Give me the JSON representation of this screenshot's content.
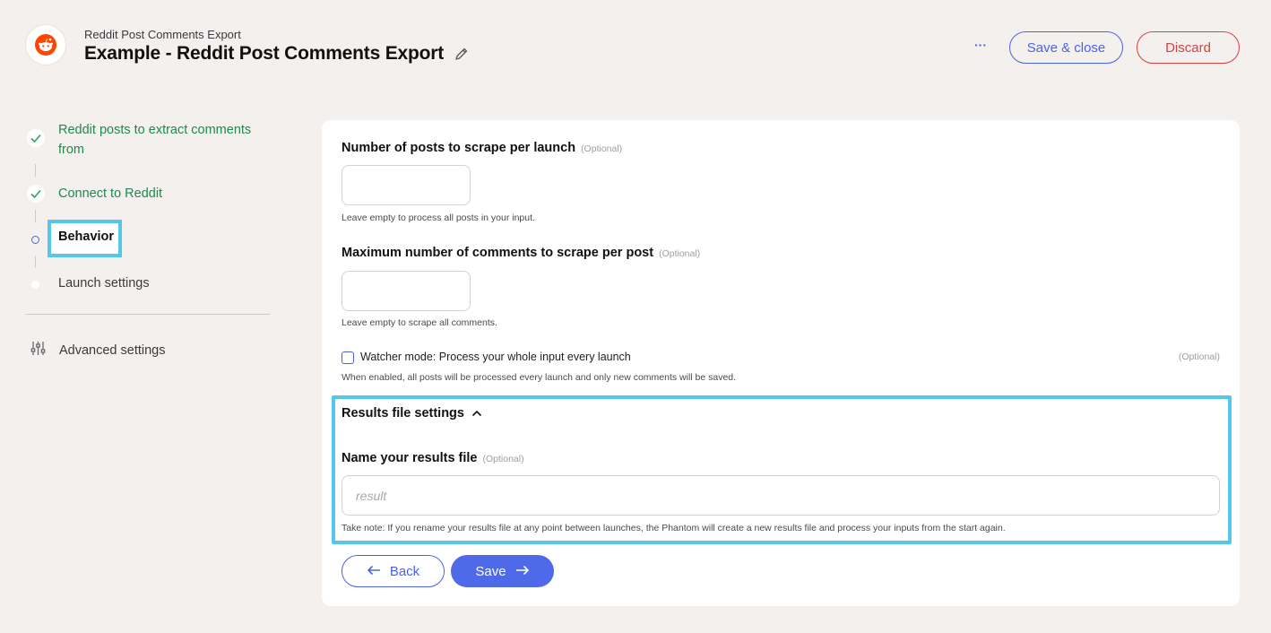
{
  "header": {
    "subtitle": "Reddit Post Comments Export",
    "title": "Example - Reddit Post Comments Export",
    "more_label": "···",
    "save_close_label": "Save & close",
    "discard_label": "Discard",
    "logo_icon": "reddit-logo",
    "brand_color": "#ff4500"
  },
  "stepper": {
    "steps": [
      {
        "label": "Reddit posts to extract comments from",
        "state": "done"
      },
      {
        "label": "Connect to Reddit",
        "state": "done"
      },
      {
        "label": "Behavior",
        "state": "current"
      },
      {
        "label": "Launch settings",
        "state": "pending"
      }
    ],
    "advanced_label": "Advanced settings"
  },
  "form": {
    "posts_per_launch": {
      "label": "Number of posts to scrape per launch",
      "optional": "(Optional)",
      "value": "",
      "help": "Leave empty to process all posts in your input."
    },
    "max_comments": {
      "label": "Maximum number of comments to scrape per post",
      "optional": "(Optional)",
      "value": "",
      "help": "Leave empty to scrape all comments."
    },
    "watcher": {
      "label": "Watcher mode: Process your whole input every launch",
      "optional": "(Optional)",
      "checked": false,
      "help": "When enabled, all posts will be processed every launch and only new comments will be saved."
    },
    "results": {
      "section_title": "Results file settings",
      "label": "Name your results file",
      "optional": "(Optional)",
      "placeholder": "result",
      "help": "Take note: If you rename your results file at any point between launches, the Phantom will create a new results file and process your inputs from the start again."
    },
    "back_label": "Back",
    "save_label": "Save"
  },
  "colors": {
    "accent": "#4a63e7",
    "danger": "#d94141",
    "success": "#1f8a4c",
    "highlight": "#55c8ea"
  }
}
